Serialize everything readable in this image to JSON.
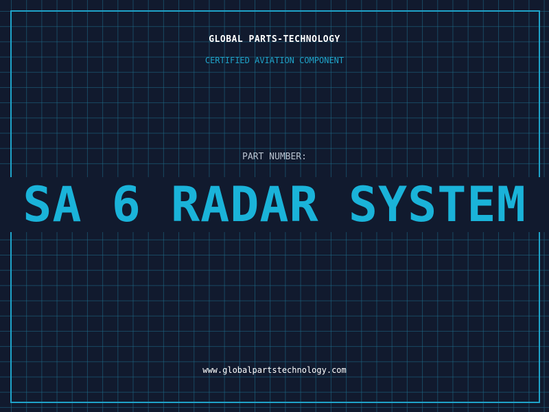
{
  "header": {
    "company": "GLOBAL PARTS-TECHNOLOGY",
    "certification": "CERTIFIED AVIATION COMPONENT"
  },
  "part": {
    "label": "PART NUMBER:",
    "number": "SA 6 RADAR SYSTEM"
  },
  "footer": {
    "website": "www.globalpartstechnology.com"
  },
  "colors": {
    "background": "#111a2e",
    "accent": "#1fa3c9",
    "part_number": "#1ab3d9"
  }
}
